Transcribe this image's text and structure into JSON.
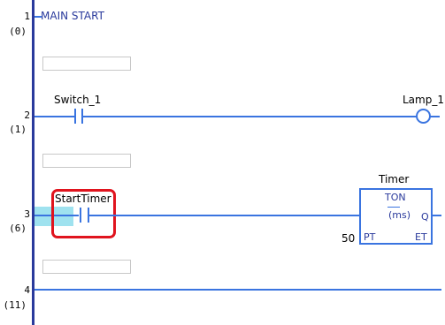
{
  "main_label": "MAIN START",
  "rungs": [
    {
      "num": "1",
      "step": "(0)"
    },
    {
      "num": "2",
      "step": "(1)"
    },
    {
      "num": "3",
      "step": "(6)"
    },
    {
      "num": "4",
      "step": "(11)"
    }
  ],
  "switch_label": "Switch_1",
  "lamp_label": "Lamp_1",
  "starttimer_label": "StartTimer",
  "timer": {
    "instance": "Timer",
    "type": "TON",
    "unit": "(ms)",
    "pt": "PT",
    "q": "Q",
    "et": "ET",
    "preset": "50"
  },
  "colors": {
    "rail": "#2a3a9c",
    "wire": "#3a74e0",
    "highlight": "#e0141e",
    "cursor": "#9fe2ef"
  }
}
